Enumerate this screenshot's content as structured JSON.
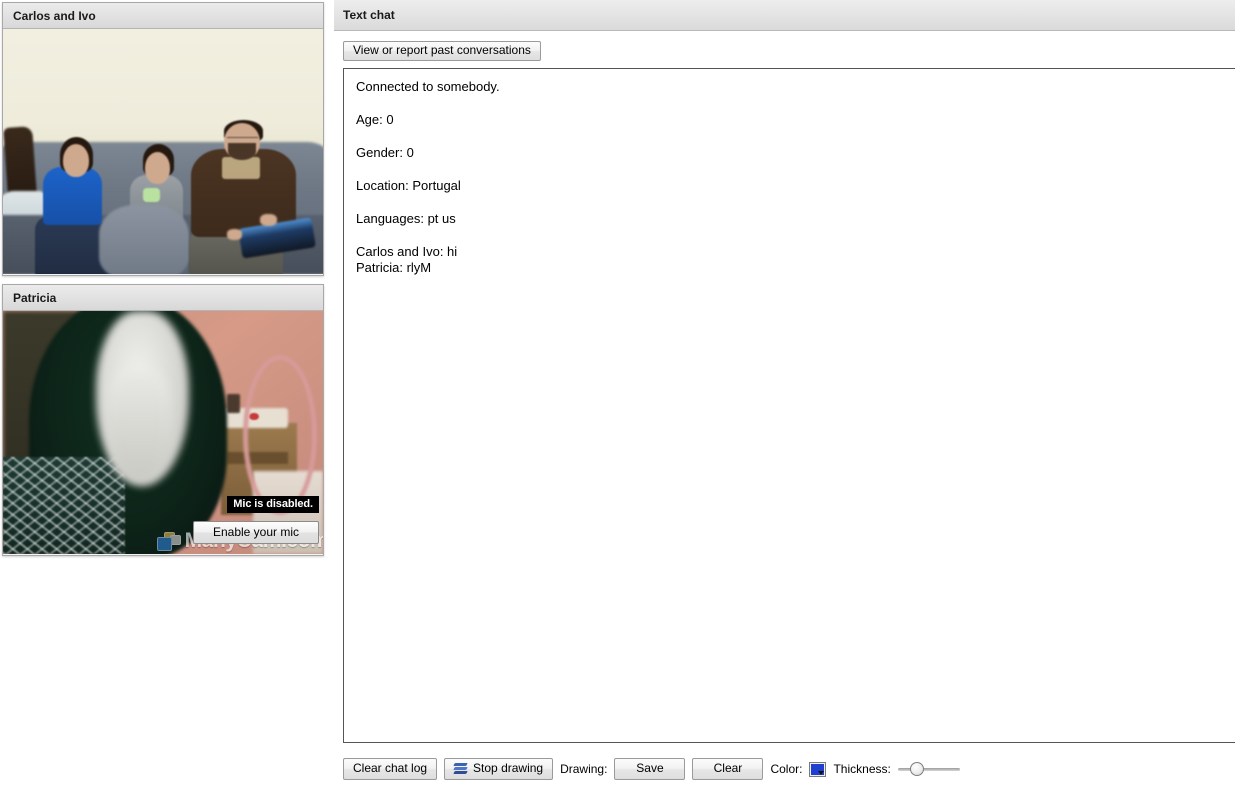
{
  "left": {
    "panels": [
      {
        "title": "Carlos and Ivo",
        "scene": "three-people-couch"
      },
      {
        "title": "Patricia",
        "scene": "person-blurred-face",
        "watermark": "ManyCam.com",
        "mic_tooltip": "Mic is disabled.",
        "mic_button": "Enable your mic"
      }
    ]
  },
  "chat": {
    "header_title": "Text chat",
    "past_conversations_label": "View or report past conversations",
    "log": [
      "Connected to somebody.",
      "Age: 0",
      "Gender: 0",
      "Location: Portugal",
      "Languages: pt us",
      "Carlos and Ivo: hi",
      "Patricia: rlyM"
    ]
  },
  "toolbar": {
    "clear_chat_log": "Clear chat log",
    "stop_drawing": "Stop drawing",
    "drawing_label": "Drawing:",
    "save": "Save",
    "clear": "Clear",
    "color_label": "Color:",
    "color_value": "#1e3fd0",
    "thickness_label": "Thickness:",
    "thickness_percent": 25
  }
}
